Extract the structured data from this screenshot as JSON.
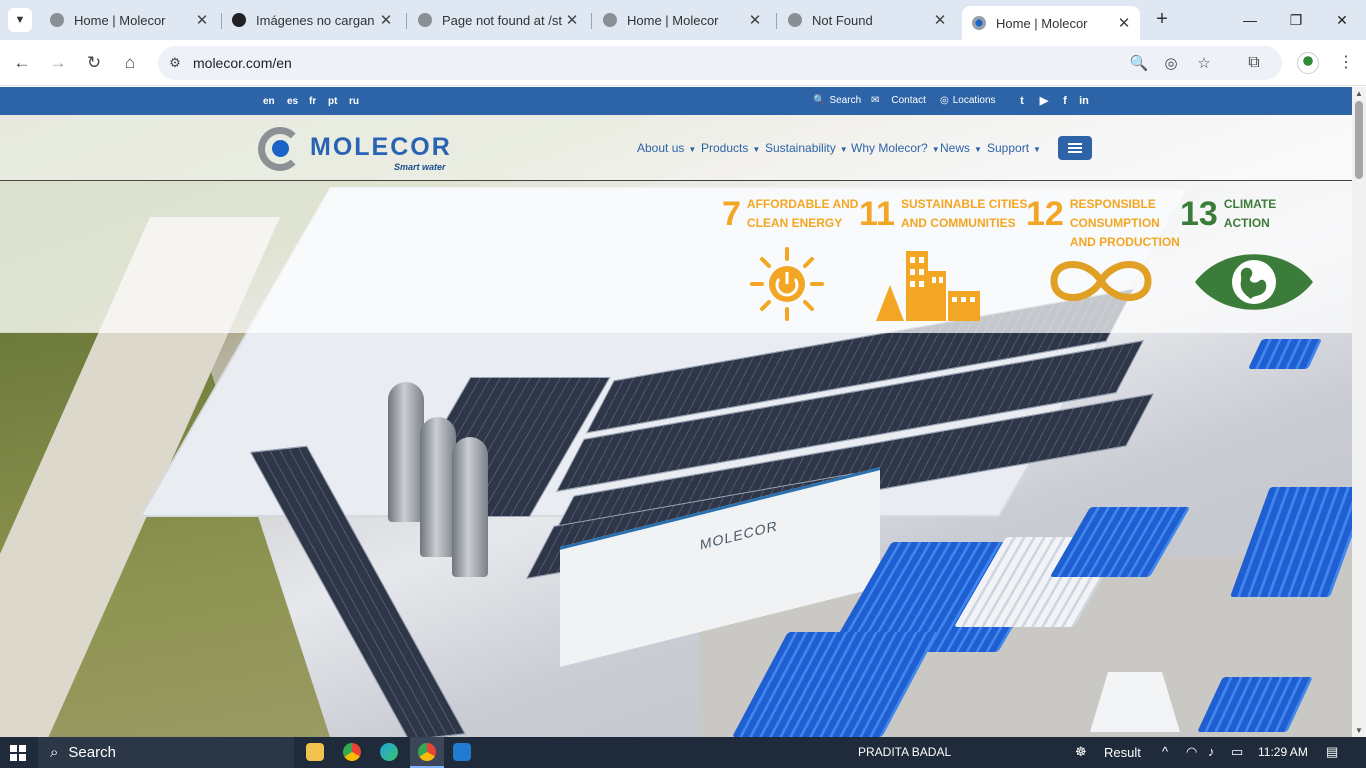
{
  "browser": {
    "tabs": [
      {
        "title": "Home | Molecor",
        "favicon": "globe-icon",
        "active": false
      },
      {
        "title": "Imágenes no cargan",
        "favicon": "openai-icon",
        "active": false
      },
      {
        "title": "Page not found at /st",
        "favicon": "globe-icon",
        "active": false
      },
      {
        "title": "Home | Molecor",
        "favicon": "globe-icon",
        "active": false
      },
      {
        "title": "Not Found",
        "favicon": "globe-icon",
        "active": false
      },
      {
        "title": "Home | Molecor",
        "favicon": "molecor-favicon",
        "active": true
      }
    ],
    "new_tab": "+",
    "url": "molecor.com/en"
  },
  "site": {
    "languages": [
      "en",
      "es",
      "fr",
      "pt",
      "ru"
    ],
    "utility": {
      "search": "Search",
      "contact": "Contact",
      "locations": "Locations"
    },
    "social": [
      "twitter-icon",
      "youtube-icon",
      "facebook-icon",
      "linkedin-icon"
    ],
    "logo": {
      "word": "MOLECOR",
      "tagline": "Smart water"
    },
    "nav": [
      "About us",
      "Products",
      "Sustainability",
      "Why Molecor?",
      "News",
      "Support"
    ],
    "goals": [
      {
        "number": "7",
        "line1": "AFFORDABLE AND",
        "line2": "CLEAN ENERGY",
        "line3": ""
      },
      {
        "number": "11",
        "line1": "SUSTAINABLE CITIES",
        "line2": "AND COMMUNITIES",
        "line3": ""
      },
      {
        "number": "12",
        "line1": "RESPONSIBLE",
        "line2": "CONSUMPTION",
        "line3": "AND PRODUCTION"
      },
      {
        "number": "13",
        "line1": "CLIMATE",
        "line2": "ACTION",
        "line3": ""
      }
    ],
    "building_sign": "MOLECOR"
  },
  "taskbar": {
    "search": "Search",
    "user": "PRADITA BADAL",
    "widget": "Result",
    "time": "11:29 AM"
  },
  "colors": {
    "brand_blue": "#2d64a8",
    "sdg_orange": "#f3a623",
    "sdg_green": "#3c7c3a"
  }
}
